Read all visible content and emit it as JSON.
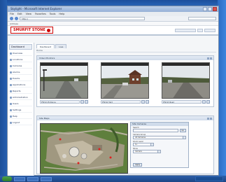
{
  "browser": {
    "title": "Skylight - Microsoft Internet Explorer",
    "menu": [
      "File",
      "Edit",
      "View",
      "Favorites",
      "Tools",
      "Help"
    ],
    "address": "http://",
    "links": "Address"
  },
  "app": {
    "logo_text": "SMURFIT STONE"
  },
  "sidebar": {
    "home_label": "Dashboard",
    "items": [
      {
        "label": "Overview"
      },
      {
        "label": "Locations"
      },
      {
        "label": "Cameras"
      },
      {
        "label": "Alarms"
      },
      {
        "label": "Events"
      },
      {
        "label": "Applications"
      },
      {
        "label": "Reports"
      },
      {
        "label": "Administration"
      },
      {
        "label": "Users"
      },
      {
        "label": "Settings"
      },
      {
        "label": "Help"
      },
      {
        "label": "Logout"
      }
    ]
  },
  "main": {
    "tabs": [
      {
        "label": "Dashboard"
      },
      {
        "label": "Live"
      }
    ],
    "breadcrumb": "Home",
    "video_panel_title": "Video Monitors",
    "cameras": [
      {
        "label": "PTZ-01 Entrance"
      },
      {
        "label": "PTZ-02 Yard"
      },
      {
        "label": "PTZ-03 Road"
      }
    ],
    "map_panel_title": "Site Maps",
    "form": {
      "title": "Site Cameras",
      "label1": "Search",
      "button1": "Go",
      "label2": "Camera Group",
      "select2": "All Cameras",
      "label3": "Zoom Level",
      "select3": "1x",
      "label4": "Show",
      "select4": "Camera",
      "apply_button": "Apply"
    }
  }
}
